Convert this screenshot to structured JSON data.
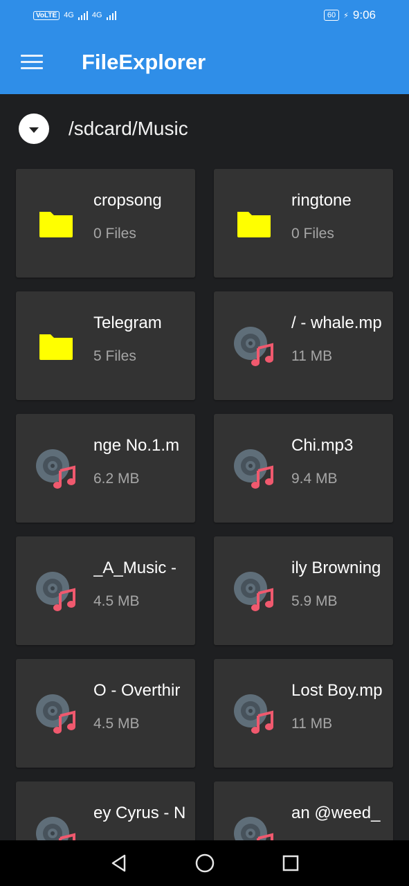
{
  "status_bar": {
    "network_badge": "VoLTE",
    "sim1": "4G",
    "sim2": "4G",
    "battery": "60",
    "time": "9:06"
  },
  "app_bar": {
    "title": "FileExplorer",
    "menu_icon": "hamburger-menu-icon"
  },
  "path_bar": {
    "toggle_icon": "chevron-down-icon",
    "path": "/sdcard/Music"
  },
  "colors": {
    "primary": "#2f8ee8",
    "background": "#1e1f21",
    "card": "#333333",
    "folder_icon": "#ffff00",
    "music_note": "#f0596e",
    "disc": "#5f6e79"
  },
  "items": [
    {
      "type": "folder",
      "name": "cropsong",
      "meta": "0 Files"
    },
    {
      "type": "folder",
      "name": "ringtone",
      "meta": "0 Files"
    },
    {
      "type": "folder",
      "name": "Telegram",
      "meta": "5 Files"
    },
    {
      "type": "music",
      "name": "/ - whale.mp",
      "meta": "11 MB"
    },
    {
      "type": "music",
      "name": "nge No.1.m",
      "meta": "6.2 MB"
    },
    {
      "type": "music",
      "name": "Chi.mp3",
      "meta": "9.4 MB"
    },
    {
      "type": "music",
      "name": "_A_Music -",
      "meta": "4.5 MB"
    },
    {
      "type": "music",
      "name": "ily Browning",
      "meta": "5.9 MB"
    },
    {
      "type": "music",
      "name": "O - Overthir",
      "meta": "4.5 MB"
    },
    {
      "type": "music",
      "name": "Lost Boy.mp",
      "meta": "11 MB"
    },
    {
      "type": "music",
      "name": "ey Cyrus - N",
      "meta": ""
    },
    {
      "type": "music",
      "name": "an @weed_",
      "meta": ""
    }
  ],
  "nav_bar": {
    "back_icon": "back-triangle-icon",
    "home_icon": "home-circle-icon",
    "recents_icon": "recents-square-icon"
  }
}
